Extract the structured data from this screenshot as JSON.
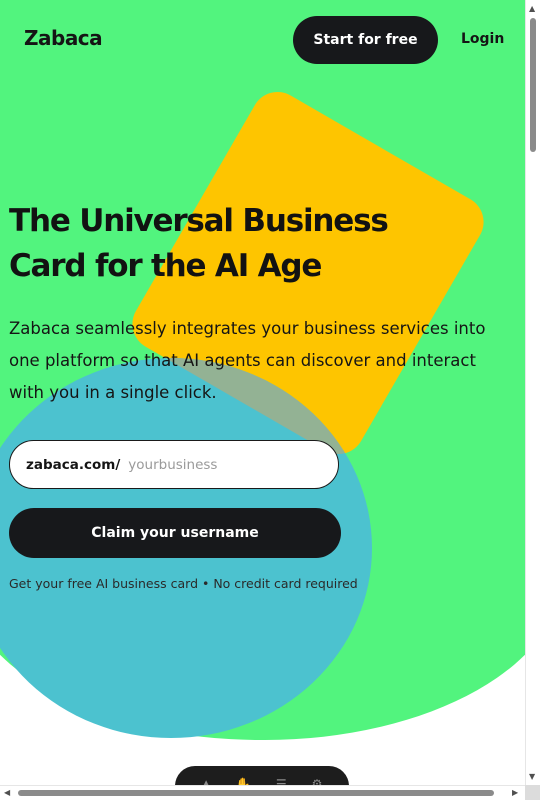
{
  "header": {
    "logo": "Zabaca",
    "start_button": "Start for free",
    "login_link": "Login"
  },
  "hero": {
    "headline_line1": "The Universal Business",
    "headline_line2": "Card for the AI Age",
    "subtitle": "Zabaca seamlessly integrates your business services into one platform so that AI agents can discover and interact with you in a single click.",
    "url_prefix": "zabaca.com/",
    "url_placeholder": "yourbusiness",
    "claim_button": "Claim your username",
    "footnote": "Get your free AI business card • No credit card required"
  },
  "colors": {
    "background_green": "#52f47e",
    "accent_yellow": "#fec500",
    "accent_teal": "#4cc2cf",
    "button_dark": "#17181b"
  },
  "icons": {
    "toolbar": [
      "bell-icon",
      "hand-icon",
      "menu-icon",
      "settings-icon"
    ]
  }
}
